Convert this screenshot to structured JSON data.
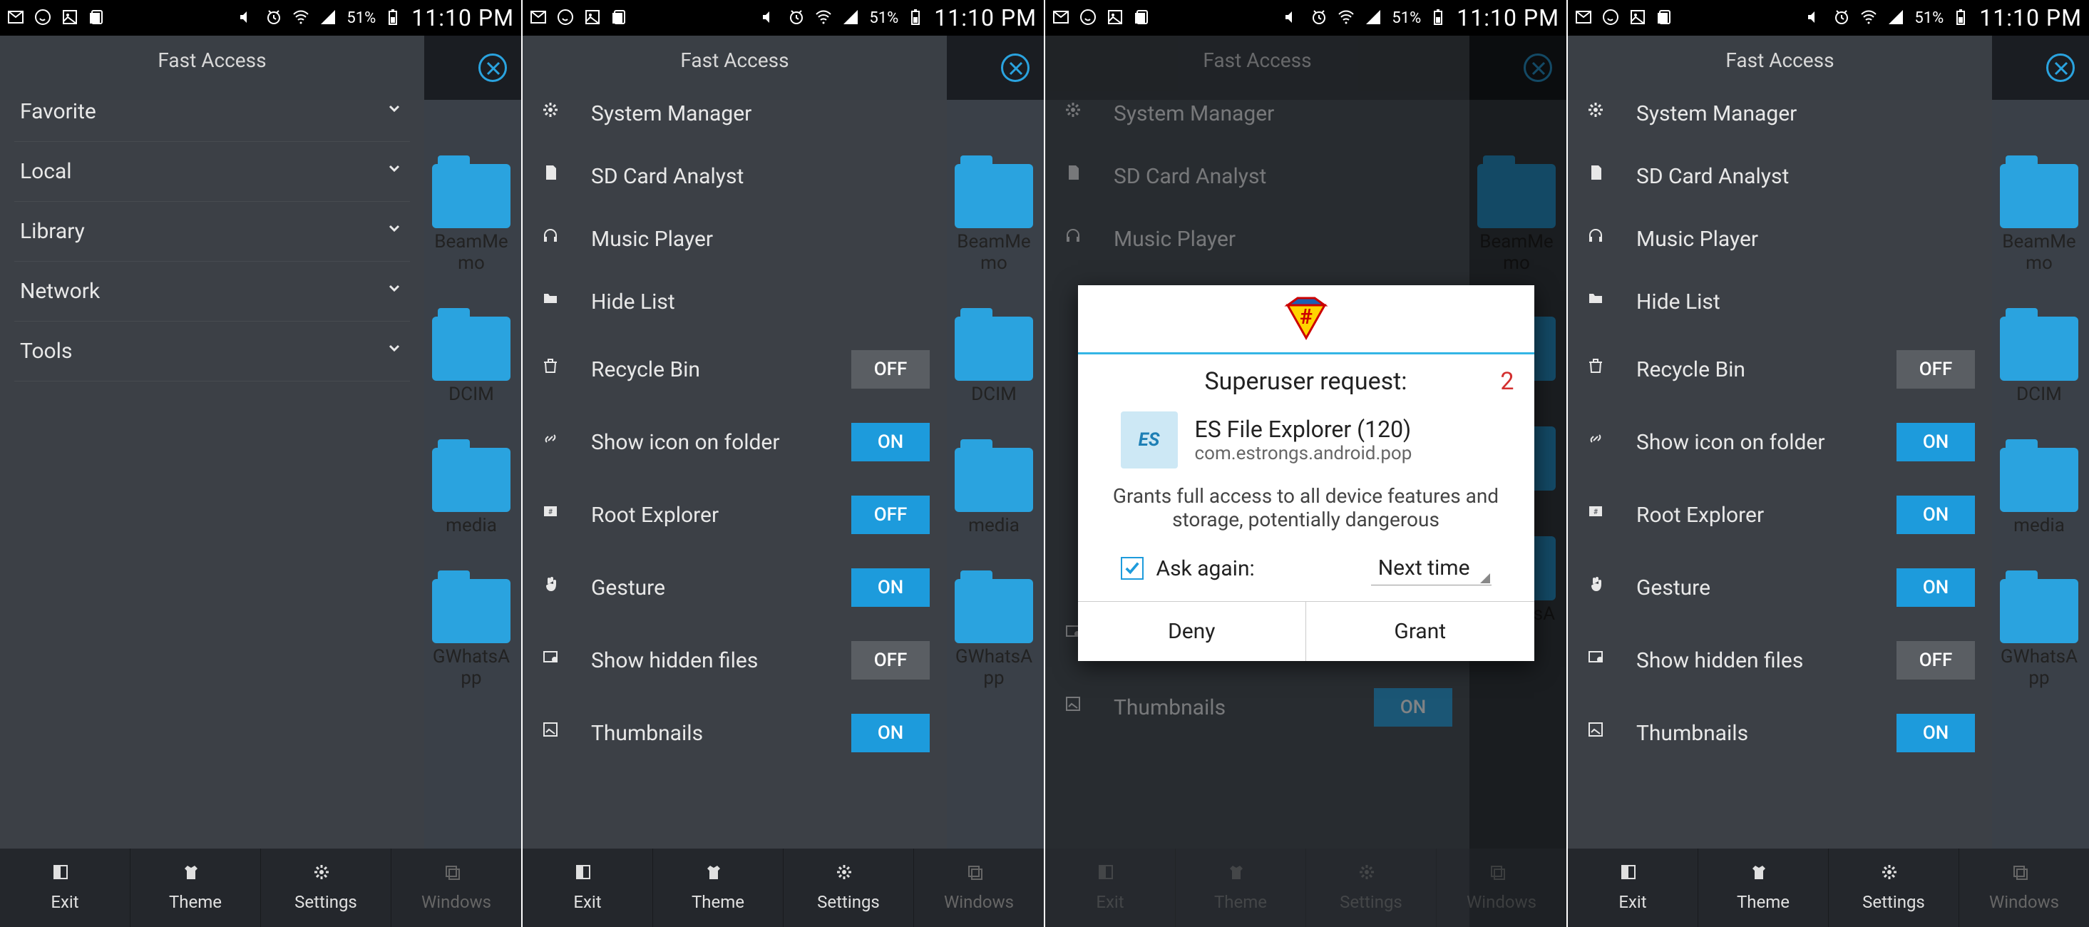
{
  "status": {
    "battery": "51%",
    "time": "11:10 PM"
  },
  "drawer_title": "Fast Access",
  "menu1": {
    "items": [
      "Favorite",
      "Local",
      "Library",
      "Network",
      "Tools"
    ]
  },
  "tools": {
    "system_manager": "System Manager",
    "sd_card_analyst": "SD Card Analyst",
    "music_player": "Music Player",
    "hide_list": "Hide List",
    "recycle_bin": "Recycle Bin",
    "show_icon_folder": "Show icon on folder",
    "root_explorer": "Root Explorer",
    "gesture": "Gesture",
    "show_hidden": "Show hidden files",
    "thumbnails": "Thumbnails"
  },
  "toggles": {
    "on": "ON",
    "off": "OFF"
  },
  "screen2_states": {
    "recycle_bin": "OFF",
    "show_icon_folder": "ON",
    "root_explorer": "OFF",
    "gesture": "ON",
    "show_hidden": "OFF",
    "thumbnails": "ON"
  },
  "screen4_states": {
    "recycle_bin": "OFF",
    "show_icon_folder": "ON",
    "root_explorer": "ON",
    "gesture": "ON",
    "show_hidden": "OFF",
    "thumbnails": "ON"
  },
  "bottom_nav": {
    "exit": "Exit",
    "theme": "Theme",
    "settings": "Settings",
    "windows": "Windows"
  },
  "folders": {
    "beammemo": "BeamMemo",
    "dcim": "DCIM",
    "media": "media",
    "gwhats": "GWhatsApp"
  },
  "dialog": {
    "title": "Superuser request:",
    "countdown": "2",
    "app_name": "ES File Explorer (120)",
    "app_pkg": "com.estrongs.android.pop",
    "desc": "Grants full access to all device features and storage, potentially dangerous",
    "ask_again": "Ask again:",
    "spinner": "Next time",
    "deny": "Deny",
    "grant": "Grant"
  }
}
